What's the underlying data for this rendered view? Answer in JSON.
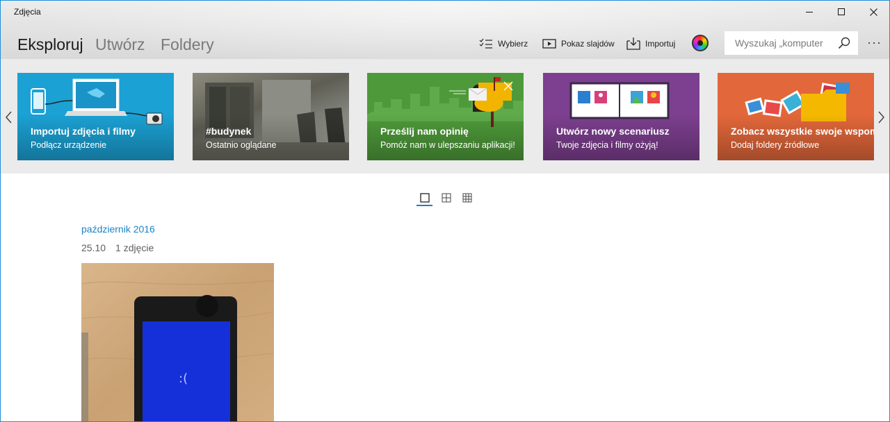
{
  "app": {
    "title": "Zdjęcia"
  },
  "window_controls": {
    "minimize_icon": "minimize-icon",
    "maximize_icon": "maximize-icon",
    "close_icon": "close-icon"
  },
  "nav": {
    "tabs": [
      {
        "label": "Eksploruj",
        "active": true
      },
      {
        "label": "Utwórz",
        "active": false
      },
      {
        "label": "Foldery",
        "active": false
      }
    ]
  },
  "toolbar": {
    "select_label": "Wybierz",
    "slideshow_label": "Pokaz slajdów",
    "import_label": "Importuj",
    "search_placeholder": "Wyszukaj „komputer",
    "more_label": "···"
  },
  "banner": {
    "cards": [
      {
        "title": "Importuj zdjęcia i filmy",
        "subtitle": "Podłącz urządzenie",
        "color": "#1ba1d4"
      },
      {
        "title": "#budynek",
        "subtitle": "Ostatnio oglądane",
        "color": "#6b6a5f"
      },
      {
        "title": "Prześlij nam opinię",
        "subtitle": "Pomóż nam w ulepszaniu aplikacji!",
        "color": "#4e9a3a"
      },
      {
        "title": "Utwórz nowy scenariusz",
        "subtitle": "Twoje zdjęcia i filmy ożyją!",
        "color": "#7d3f8f"
      },
      {
        "title": "Zobacz wszystkie swoje wspomnienia",
        "subtitle": "Dodaj foldery źródłowe",
        "color": "#e2673a"
      }
    ]
  },
  "view": {
    "modes": [
      "single",
      "medium-grid",
      "small-grid"
    ],
    "selected": "single",
    "accent": "#1a7fc6"
  },
  "collection": {
    "month": "październik 2016",
    "date": "25.10",
    "count": "1 zdjęcie"
  }
}
